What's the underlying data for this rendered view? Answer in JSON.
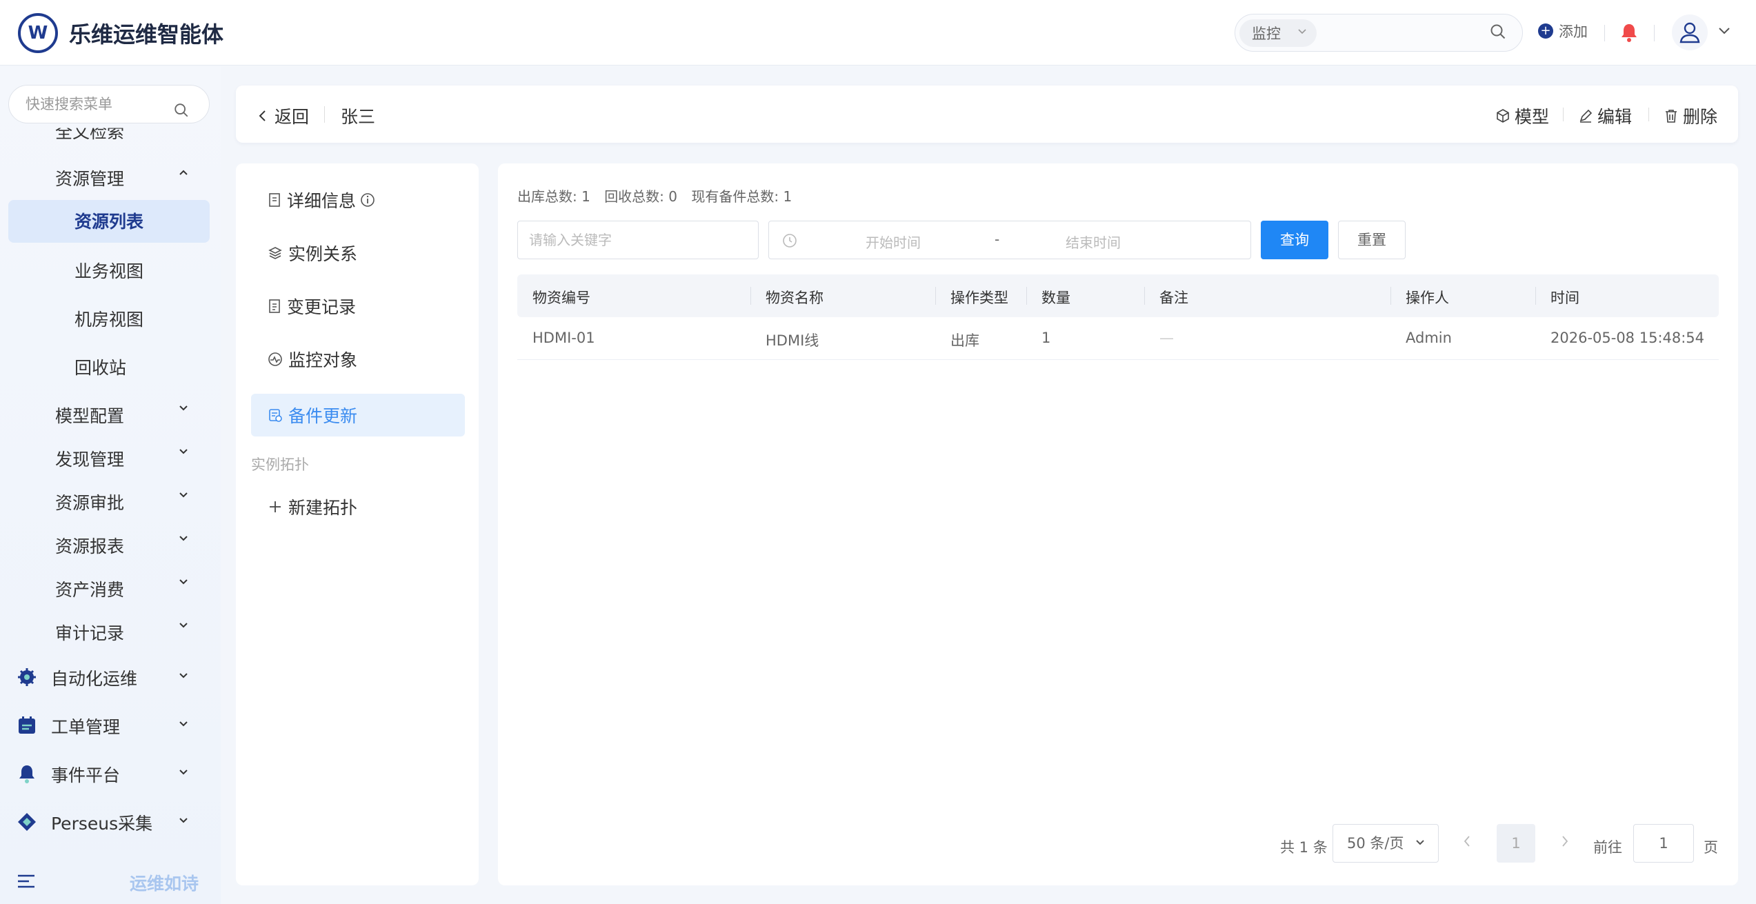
{
  "app": {
    "title": "乐维运维智能体",
    "logo_letter": "W",
    "brand_color": "#1f3b8f"
  },
  "topbar": {
    "search_scope": "监控",
    "add_label": "添加",
    "icons": [
      "search-icon",
      "add-circle-icon",
      "bell-icon",
      "user-icon",
      "chevron-down-icon"
    ]
  },
  "sidebar": {
    "search_placeholder": "快速搜索菜单",
    "partial_top_item": "全文检索",
    "group": {
      "label": "资源管理",
      "children": [
        "资源列表",
        "业务视图",
        "机房视图",
        "回收站"
      ],
      "active": "资源列表"
    },
    "sub_menus": [
      "模型配置",
      "发现管理",
      "资源审批",
      "资源报表",
      "资产消费",
      "审计记录"
    ],
    "categories": [
      "自动化运维",
      "工单管理",
      "事件平台",
      "Perseus采集"
    ],
    "footer_text": "运维如诗",
    "active_color": "#dde9fb"
  },
  "header": {
    "back_label": "返回",
    "crumb": "张三",
    "actions": [
      "模型",
      "编辑",
      "删除"
    ]
  },
  "left_nav": {
    "items": [
      "详细信息",
      "实例关系",
      "变更记录",
      "监控对象",
      "备件更新"
    ],
    "active": "备件更新",
    "section_label": "实例拓扑",
    "new_topology": "新建拓扑"
  },
  "main": {
    "stats": [
      "出库总数: 1",
      "回收总数: 0",
      "现有备件总数: 1"
    ],
    "keyword_placeholder": "请输入关键字",
    "start_placeholder": "开始时间",
    "range_sep": "-",
    "end_placeholder": "结束时间",
    "query_label": "查询",
    "reset_label": "重置",
    "primary_color": "#1f87f5",
    "table": {
      "columns": [
        "物资编号",
        "物资名称",
        "操作类型",
        "数量",
        "备注",
        "操作人",
        "时间"
      ],
      "rows": [
        [
          "HDMI-01",
          "HDMI线",
          "出库",
          "1",
          "—",
          "Admin",
          "2026-05-08 15:48:54"
        ]
      ]
    },
    "pagination": {
      "total": "共 1 条",
      "page_size": "50 条/页",
      "current_page": "1",
      "goto_label": "前往",
      "goto_value": "1",
      "page_unit": "页"
    }
  }
}
